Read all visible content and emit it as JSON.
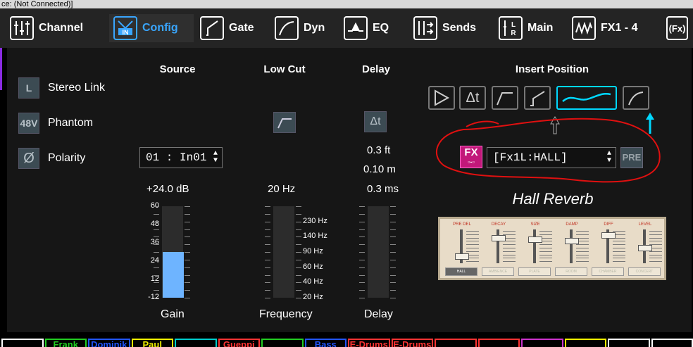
{
  "titlebar": {
    "text": "ce: (Not Connected)]"
  },
  "tabs": [
    {
      "label": "Channel",
      "icon": "channel-icon"
    },
    {
      "label": "Config",
      "icon": "config-in-icon",
      "active": true
    },
    {
      "label": "Gate",
      "icon": "gate-icon"
    },
    {
      "label": "Dyn",
      "icon": "dyn-icon"
    },
    {
      "label": "EQ",
      "icon": "eq-icon"
    },
    {
      "label": "Sends",
      "icon": "sends-icon"
    },
    {
      "label": "Main",
      "icon": "main-lr-icon"
    },
    {
      "label": "FX1 - 4",
      "icon": "fx-wave-icon"
    },
    {
      "label": "",
      "icon": "fx-bracket-icon"
    }
  ],
  "tab_icon_text": {
    "config": "IN",
    "main_l": "L",
    "main_r": "R",
    "fx": "(Fx)"
  },
  "left": {
    "stereo_link": {
      "button": "L",
      "label": "Stereo Link"
    },
    "phantom": {
      "button": "48V",
      "label": "Phantom"
    },
    "polarity": {
      "button": "Ø",
      "label": "Polarity"
    }
  },
  "source": {
    "header": "Source",
    "select_value": "01 : In01",
    "gain_value": "+24.0 dB",
    "gain_level_db": 24,
    "scale": [
      "60",
      "48",
      "36",
      "24",
      "12",
      "-12"
    ],
    "label": "Gain"
  },
  "lowcut": {
    "header": "Low Cut",
    "value": "20 Hz",
    "scale": [
      "230 Hz",
      "140 Hz",
      "90 Hz",
      "60 Hz",
      "40 Hz",
      "20 Hz"
    ],
    "label": "Frequency"
  },
  "delay": {
    "header": "Delay",
    "button": "Δt",
    "ft": "0.3 ft",
    "m": "0.10 m",
    "ms": "0.3 ms",
    "label": "Delay"
  },
  "insert": {
    "header": "Insert Position",
    "fx_button": "FX",
    "select_value": "[Fx1L:HALL]",
    "pre_button": "PRE",
    "effect_name": "Hall Reverb",
    "reverb_params": [
      "PRE DEL",
      "DECAY",
      "SIZE",
      "DAMP",
      "DIFF",
      "LEVEL"
    ],
    "reverb_types": [
      "HALL",
      "AMBIENCE",
      "PLATE",
      "ROOM",
      "CHAMBER",
      "CONCERT"
    ]
  },
  "channels": [
    {
      "label": "",
      "color": "#ffffff"
    },
    {
      "label": "Frank",
      "color": "#22cc22"
    },
    {
      "label": "Dominik",
      "color": "#2255ff"
    },
    {
      "label": "Paul",
      "color": "#eeee00"
    },
    {
      "label": "",
      "color": "#00cccc"
    },
    {
      "label": "Gueppi",
      "color": "#ff3333"
    },
    {
      "label": "",
      "color": "#22cc22"
    },
    {
      "label": "Bass",
      "color": "#2255ff"
    },
    {
      "label": "E-Drums",
      "color": "#ff3333"
    },
    {
      "label": "E-Drums",
      "color": "#ff3333"
    },
    {
      "label": "",
      "color": "#ff3333"
    },
    {
      "label": "",
      "color": "#ff3333"
    },
    {
      "label": "",
      "color": "#cc33cc"
    },
    {
      "label": "",
      "color": "#eeee00"
    },
    {
      "label": "",
      "color": "#ffffff"
    },
    {
      "label": "",
      "color": "#ffffff"
    }
  ],
  "colors": {
    "accent": "#39a6ff",
    "meter": "#6eb4ff",
    "insert_active": "#00d8ff",
    "fx_button": "#c2187a",
    "annotation": "#e01010"
  }
}
